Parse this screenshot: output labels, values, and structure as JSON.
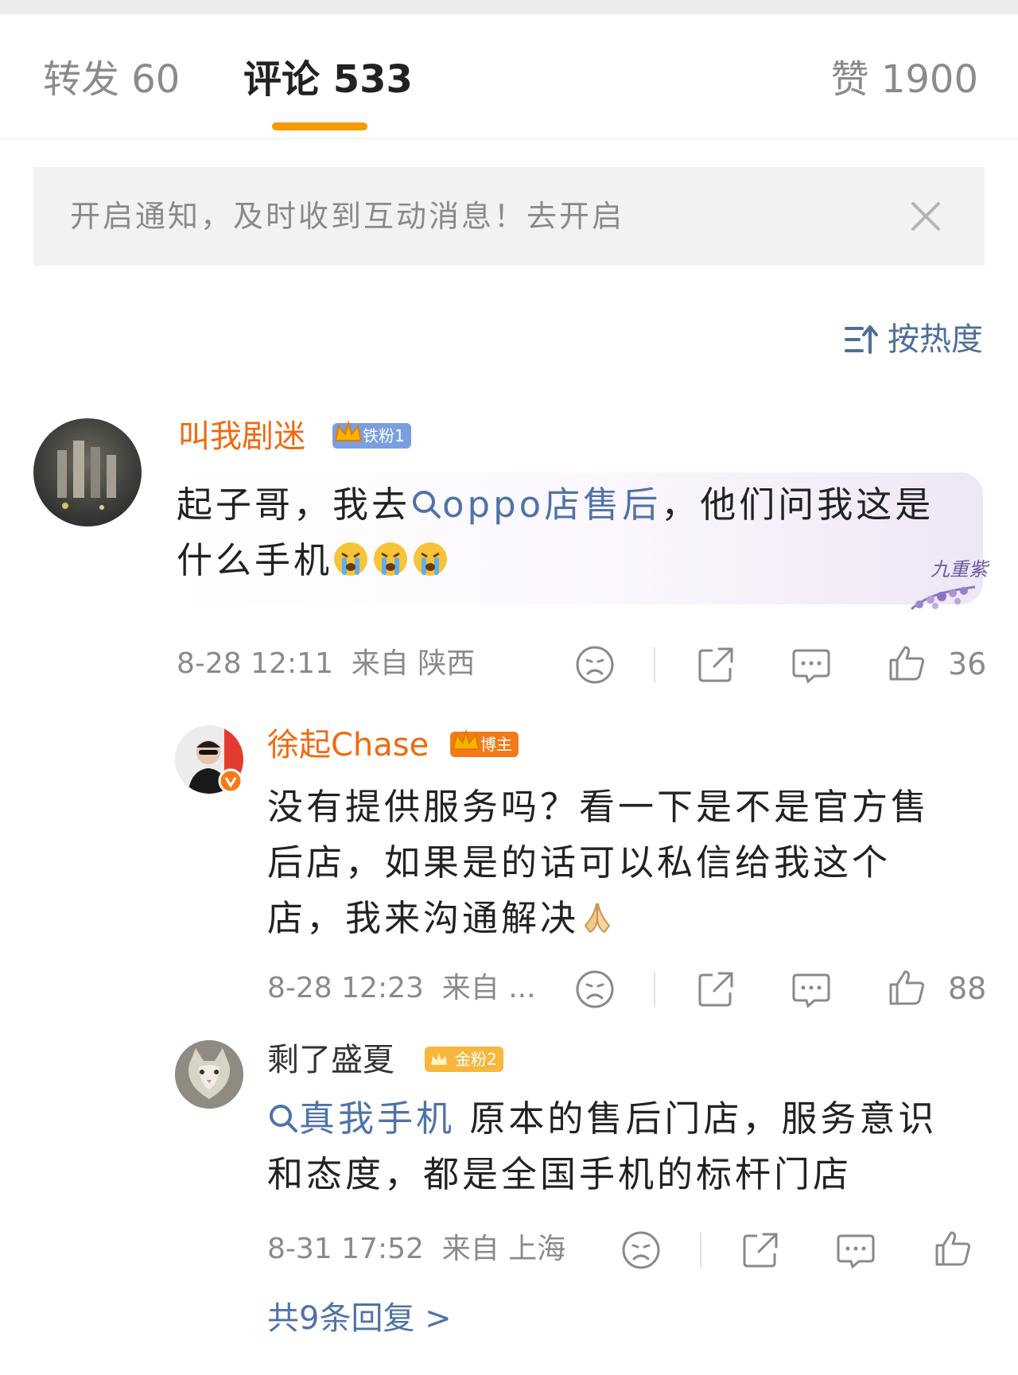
{
  "tabs": {
    "repost": "转发 60",
    "comments": "评论 533",
    "likes": "赞 1900"
  },
  "notice": {
    "text": "开启通知，及时收到互动消息！去开启",
    "close_icon": "close-icon"
  },
  "sort": {
    "label": "按热度",
    "icon": "sort-icon"
  },
  "colors": {
    "accent": "#f59a00",
    "username_highlight": "#f06a0f",
    "link": "#4f73a8",
    "meta": "#8a8a8a"
  },
  "comments": [
    {
      "username": "叫我剧迷",
      "badge": "铁粉1",
      "text_before": "起子哥，我去",
      "link": "oppo店售后",
      "text_after": "，他们问我这是什么手机",
      "emoji": [
        "crying-face",
        "crying-face",
        "crying-face"
      ],
      "time": "8-28 12:11",
      "location": "来自 陕西",
      "likes": "36",
      "bubble_watermark": "九重紫"
    },
    {
      "username": "徐起Chase",
      "badge": "博主",
      "text": "没有提供服务吗？看一下是不是官方售后店，如果是的话可以私信给我这个店，我来沟通解决",
      "emoji": [
        "folded-hands"
      ],
      "time": "8-28 12:23",
      "location": "来自 ...",
      "likes": "88"
    },
    {
      "username": "剩了盛夏",
      "badge": "金粉2",
      "link": "真我手机",
      "text_after": "原本的售后门店，服务意识和态度，都是全国手机的标杆门店",
      "time": "8-31 17:52",
      "location": "来自 上海",
      "likes": ""
    }
  ],
  "replies_link": "共9条回复 >"
}
